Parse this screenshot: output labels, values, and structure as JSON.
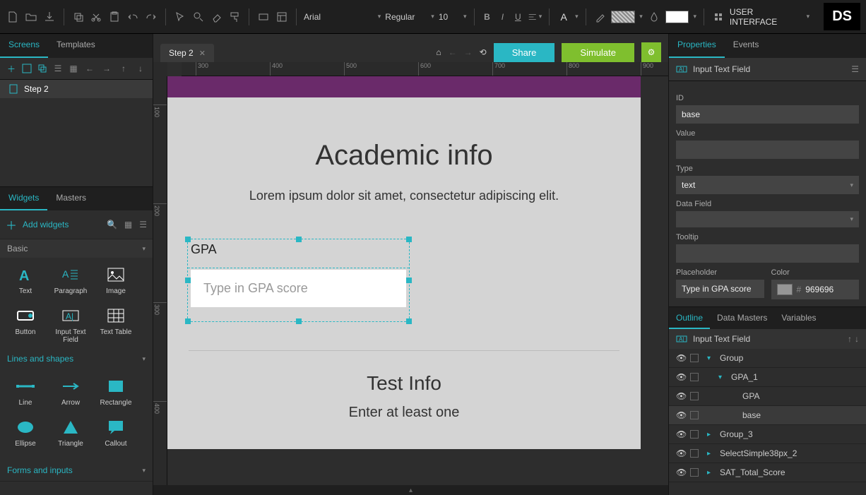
{
  "toolbar": {
    "font": "Arial",
    "weight": "Regular",
    "size": "10",
    "ui_label": "USER INTERFACE",
    "brand": "DS"
  },
  "left": {
    "tabs": {
      "screens": "Screens",
      "templates": "Templates"
    },
    "screen_item": "Step 2",
    "widgets": {
      "tabs": {
        "widgets": "Widgets",
        "masters": "Masters"
      },
      "add": "Add widgets",
      "group_basic": "Basic",
      "items_basic": [
        "Text",
        "Paragraph",
        "Image",
        "Button",
        "Input Text Field",
        "Text Table"
      ],
      "group_lines": "Lines and shapes",
      "items_lines": [
        "Line",
        "Arrow",
        "Rectangle",
        "Ellipse",
        "Triangle",
        "Callout"
      ],
      "group_forms": "Forms and inputs"
    }
  },
  "center": {
    "tab": "Step 2",
    "share": "Share",
    "simulate": "Simulate",
    "ruler_h": [
      "300",
      "400",
      "500",
      "600",
      "700",
      "800",
      "900"
    ],
    "ruler_v": [
      "100",
      "200",
      "300",
      "400"
    ],
    "page": {
      "h1": "Academic info",
      "sub": "Lorem ipsum dolor sit amet, consectetur adipiscing elit.",
      "gpa_label": "GPA",
      "gpa_placeholder": "Type in GPA score",
      "h2": "Test Info",
      "sub2": "Enter at least one"
    }
  },
  "right": {
    "tabs": {
      "properties": "Properties",
      "events": "Events"
    },
    "prop_header": "Input Text Field",
    "id_label": "ID",
    "id_value": "base",
    "value_label": "Value",
    "value_value": "",
    "type_label": "Type",
    "type_value": "text",
    "datafield_label": "Data Field",
    "datafield_value": "",
    "tooltip_label": "Tooltip",
    "tooltip_value": "",
    "placeholder_label": "Placeholder",
    "placeholder_value": "Type in GPA score",
    "color_label": "Color",
    "color_value": "969696",
    "outline_tabs": {
      "outline": "Outline",
      "dm": "Data Masters",
      "vars": "Variables"
    },
    "outline_header": "Input Text Field",
    "outline_items": [
      {
        "label": "Group",
        "indent": 0,
        "arrow": "down"
      },
      {
        "label": "GPA_1",
        "indent": 1,
        "arrow": "down"
      },
      {
        "label": "GPA",
        "indent": 2,
        "arrow": ""
      },
      {
        "label": "base",
        "indent": 2,
        "arrow": "",
        "sel": true
      },
      {
        "label": "Group_3",
        "indent": 0,
        "arrow": "right"
      },
      {
        "label": "SelectSimple38px_2",
        "indent": 0,
        "arrow": "right"
      },
      {
        "label": "SAT_Total_Score",
        "indent": 0,
        "arrow": "right"
      }
    ]
  }
}
